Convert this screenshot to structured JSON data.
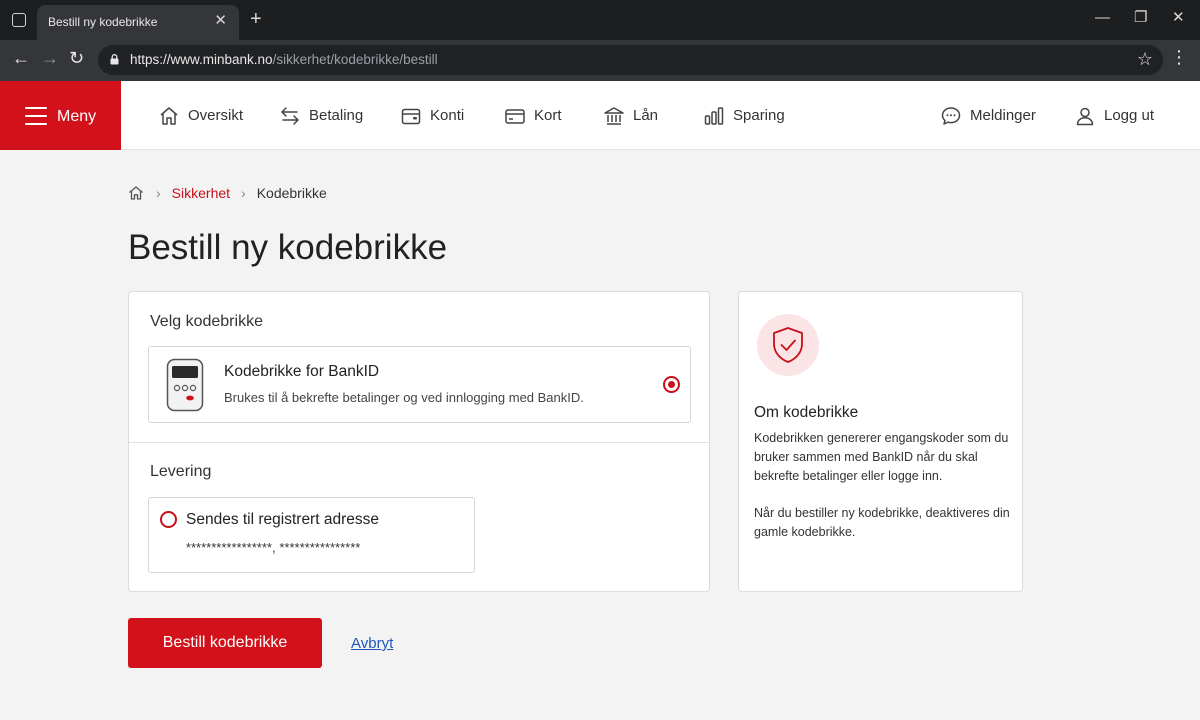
{
  "browser": {
    "tab_title": "Bestill ny kodebrikke",
    "url_main": "https://www.minbank.no",
    "url_path": "/sikkerhet/kodebrikke/bestill"
  },
  "header": {
    "menu_label": "Meny",
    "nav": [
      {
        "label": "Oversikt",
        "icon": "home-icon"
      },
      {
        "label": "Betaling",
        "icon": "transfer-arrows-icon"
      },
      {
        "label": "Konti",
        "icon": "wallet-icon"
      },
      {
        "label": "Kort",
        "icon": "card-icon"
      },
      {
        "label": "Lån",
        "icon": "bank-building-icon"
      },
      {
        "label": "Sparing",
        "icon": "bar-chart-icon"
      }
    ],
    "messages_label": "Meldinger",
    "logout_label": "Logg ut"
  },
  "breadcrumb": {
    "items": [
      "Sikkerhet",
      "Kodebrikke"
    ]
  },
  "page_title": "Bestill ny kodebrikke",
  "select_section": {
    "title": "Velg kodebrikke",
    "option_title": "Kodebrikke for BankID",
    "option_desc": "Brukes til å bekrefte betalinger og ved innlogging med BankID.",
    "selected": true
  },
  "delivery_section": {
    "title": "Levering",
    "option_title": "Sendes til registrert adresse",
    "option_address": "*****************, ****************",
    "selected": false
  },
  "info": {
    "title": "Om kodebrikke",
    "para1": "Kodebrikken genererer engangskoder som du bruker sammen med BankID når du skal bekrefte betalinger eller logge inn.",
    "para2": "Når du bestiller ny kodebrikke, deaktiveres din gamle kodebrikke."
  },
  "actions": {
    "order_label": "Bestill kodebrikke",
    "cancel_label": "Avbryt"
  },
  "colors": {
    "brand_red": "#d3111b",
    "link_blue": "#2158b8"
  }
}
